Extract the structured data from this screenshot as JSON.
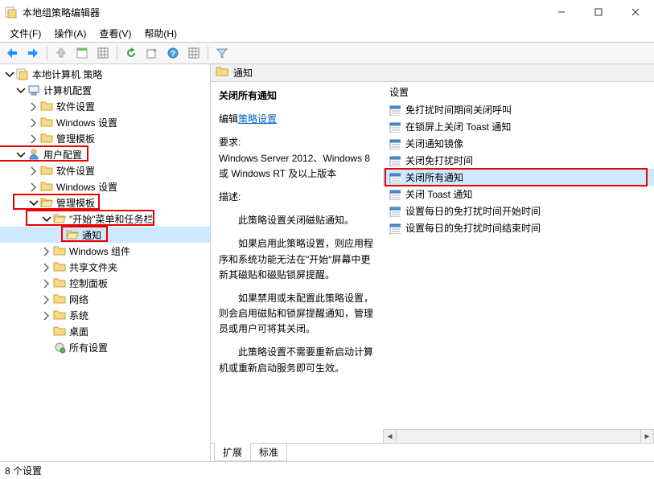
{
  "window": {
    "title": "本地组策略编辑器"
  },
  "menu": {
    "file": "文件(F)",
    "action": "操作(A)",
    "view": "查看(V)",
    "help": "帮助(H)"
  },
  "tree": {
    "root": "本地计算机 策略",
    "computer_config": "计算机配置",
    "cc_software": "软件设置",
    "cc_windows": "Windows 设置",
    "cc_admin": "管理模板",
    "user_config": "用户配置",
    "uc_software": "软件设置",
    "uc_windows": "Windows 设置",
    "uc_admin": "管理模板",
    "start_taskbar": "\"开始\"菜单和任务栏",
    "notifications": "通知",
    "windows_components": "Windows 组件",
    "shared_folders": "共享文件夹",
    "control_panel": "控制面板",
    "network": "网络",
    "system": "系统",
    "desktop": "桌面",
    "all_settings": "所有设置"
  },
  "right": {
    "header": "通知",
    "selected_title": "关闭所有通知",
    "edit_prefix": "编辑",
    "edit_link": "策略设置",
    "req_label": "要求:",
    "req_text": "Windows Server 2012、Windows 8 或 Windows RT 及以上版本",
    "desc_label": "描述:",
    "desc_p1": "此策略设置关闭磁贴通知。",
    "desc_p2": "如果启用此策略设置，则应用程序和系统功能无法在\"开始\"屏幕中更新其磁贴和磁贴锁屏提醒。",
    "desc_p3": "如果禁用或未配置此策略设置，则会启用磁贴和锁屏提醒通知，管理员或用户可将其关闭。",
    "desc_p4": "此策略设置不需要重新启动计算机或重新启动服务即可生效。",
    "col_setting": "设置",
    "items": [
      "免打扰时间期间关闭呼叫",
      "在锁屏上关闭 Toast 通知",
      "关闭通知镜像",
      "关闭免打扰时间",
      "关闭所有通知",
      "关闭 Toast 通知",
      "设置每日的免打扰时间开始时间",
      "设置每日的免打扰时间结束时间"
    ],
    "selected_index": 4
  },
  "tabs": {
    "extended": "扩展",
    "standard": "标准"
  },
  "status": {
    "text": "8 个设置"
  }
}
